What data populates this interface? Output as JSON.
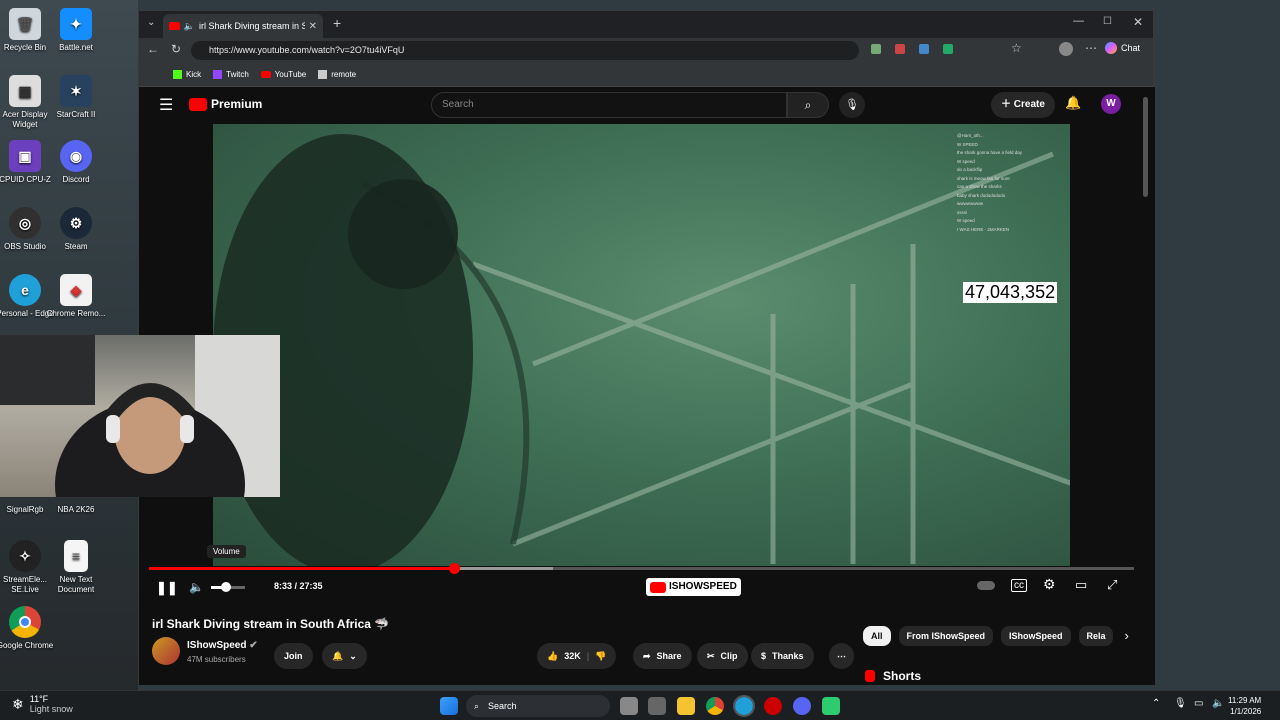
{
  "desktop": {
    "icons": [
      "Recycle Bin",
      "Battle.net",
      "Acer Display Widget",
      "StarCraft II",
      "CPUID CPU-Z",
      "Discord",
      "OBS Studio",
      "Steam",
      "Personal - Edge",
      "Chrome Remo...",
      "SignalRgb",
      "NBA 2K26",
      "StreamEle... SE.Live",
      "New Text Document",
      "Google Chrome"
    ]
  },
  "browser": {
    "tab_title": "irl Shark Diving stream in Sout",
    "url": "https://www.youtube.com/watch?v=2O7tu4iVFqU",
    "bookmarks": [
      "Kick",
      "Twitch",
      "YouTube",
      "remote"
    ],
    "chat_label": "Chat"
  },
  "yt": {
    "logo": "Premium",
    "search_placeholder": "Search",
    "create": "Create",
    "avatar": "W"
  },
  "video": {
    "viewcount": "47,043,352",
    "tooltip": "Volume",
    "time": "8:33 / 27:35",
    "progress": 0.31,
    "buffered": 0.41,
    "overlay": "ISHOWSPEED",
    "chat_lines": [
      "@Ham_oth...",
      "W SPEED",
      "the shark gonna have a field day",
      "W speed",
      "do a backflip",
      "shark is meow fan for sure",
      "can u show the sharks",
      "baby shark dododododo",
      "wwwwwwww",
      "ssssi",
      "W speed",
      "I WAS HERE · 2MARKEN"
    ]
  },
  "meta": {
    "title": "irl Shark Diving stream in South Africa 🦈",
    "channel": "IShowSpeed",
    "subs": "47M subscribers",
    "join": "Join",
    "likes": "32K",
    "share": "Share",
    "clip": "Clip",
    "thanks": "Thanks"
  },
  "filters": [
    "All",
    "From IShowSpeed",
    "IShowSpeed",
    "Rela"
  ],
  "shorts": "Shorts",
  "taskbar": {
    "weather_temp": "11°F",
    "weather_desc": "Light snow",
    "search": "Search",
    "time": "11:29 AM",
    "date": "1/1/2026"
  }
}
